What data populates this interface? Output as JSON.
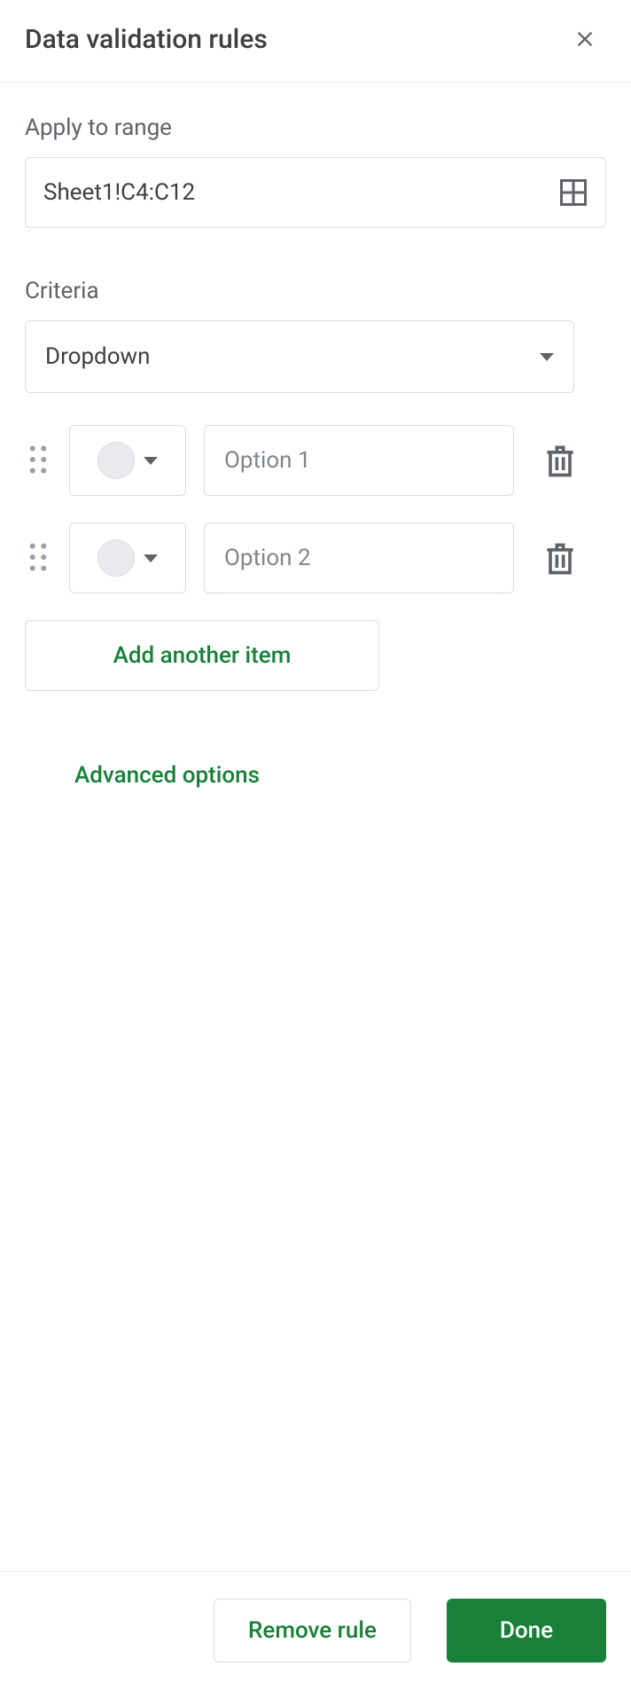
{
  "header": {
    "title": "Data validation rules"
  },
  "apply_range": {
    "label": "Apply to range",
    "value": "Sheet1!C4:C12"
  },
  "criteria": {
    "label": "Criteria",
    "selected": "Dropdown"
  },
  "options": [
    {
      "placeholder": "Option 1",
      "value": ""
    },
    {
      "placeholder": "Option 2",
      "value": ""
    }
  ],
  "buttons": {
    "add_item": "Add another item",
    "advanced": "Advanced options",
    "remove_rule": "Remove rule",
    "done": "Done"
  }
}
